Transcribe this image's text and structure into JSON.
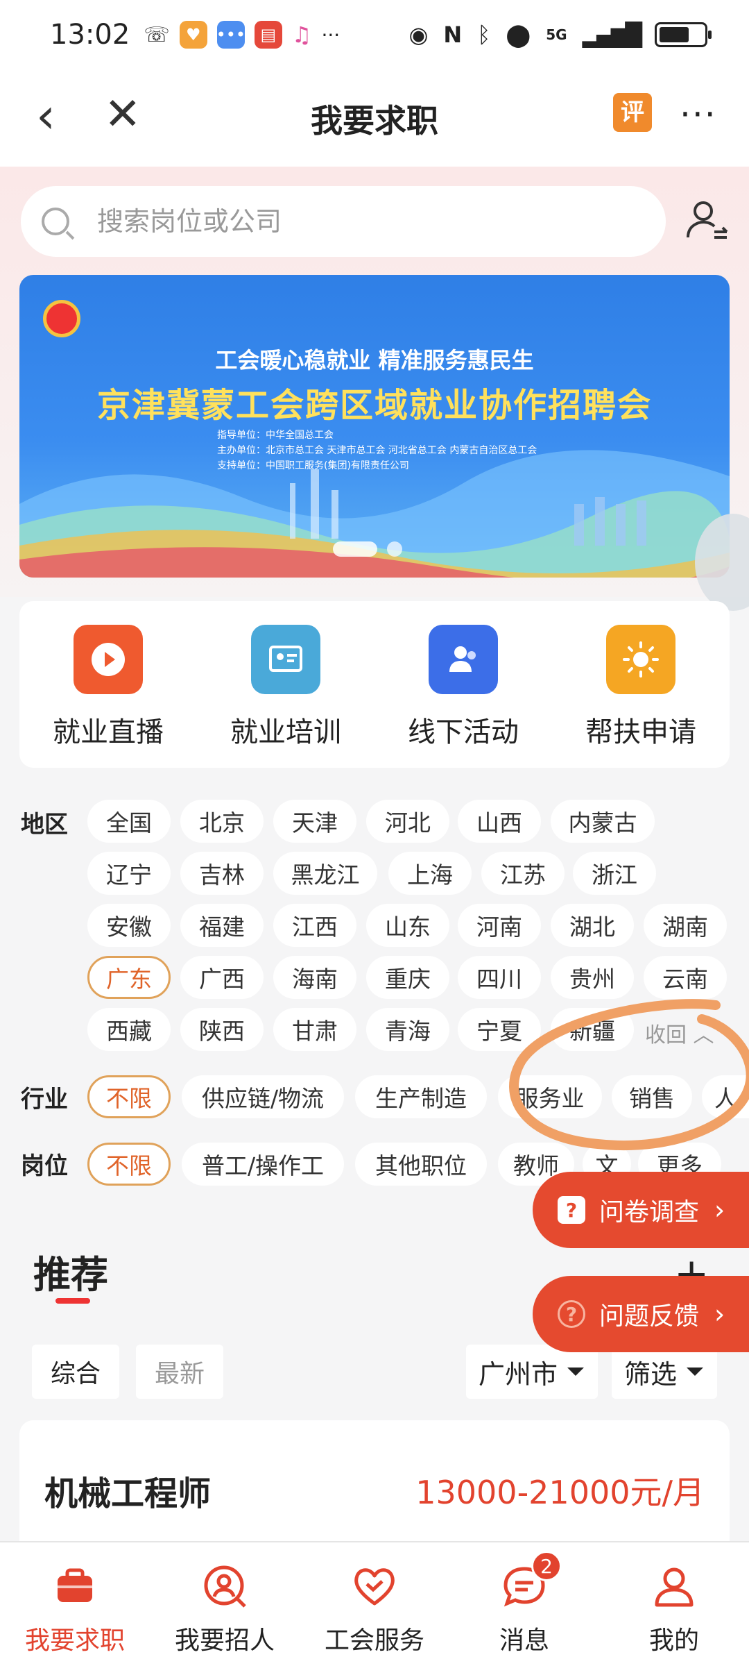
{
  "status_bar": {
    "time": "13:02",
    "more": "···",
    "network": "5G"
  },
  "nav": {
    "title": "我要求职",
    "review_badge": "评",
    "more": "···"
  },
  "search": {
    "placeholder": "搜索岗位或公司"
  },
  "banner": {
    "subtitle": "工会暖心稳就业   精准服务惠民生",
    "title": "京津冀蒙工会跨区域就业协作招聘会",
    "lines": [
      "指导单位：中华全国总工会",
      "主办单位：北京市总工会    天津市总工会    河北省总工会    内蒙古自治区总工会",
      "支持单位：中国职工服务(集团)有限责任公司"
    ]
  },
  "features": [
    {
      "label": "就业直播",
      "icon": "play-icon",
      "color": "#ef5a2f"
    },
    {
      "label": "就业培训",
      "icon": "training-icon",
      "color": "#4aa9d9"
    },
    {
      "label": "线下活动",
      "icon": "people-icon",
      "color": "#3c6ee8"
    },
    {
      "label": "帮扶申请",
      "icon": "sun-icon",
      "color": "#f5a623"
    }
  ],
  "filters": {
    "region_label": "地区",
    "regions": [
      "全国",
      "北京",
      "天津",
      "河北",
      "山西",
      "内蒙古",
      "辽宁",
      "吉林",
      "黑龙江",
      "上海",
      "江苏",
      "浙江",
      "安徽",
      "福建",
      "江西",
      "山东",
      "河南",
      "湖北",
      "湖南",
      "广东",
      "广西",
      "海南",
      "重庆",
      "四川",
      "贵州",
      "云南",
      "西藏",
      "陕西",
      "甘肃",
      "青海",
      "宁夏",
      "新疆"
    ],
    "region_selected": "广东",
    "collapse": "收回",
    "industry_label": "行业",
    "industries": [
      "不限",
      "供应链/物流",
      "生产制造",
      "服务业",
      "销售",
      "人"
    ],
    "position_label": "岗位",
    "positions": [
      "不限",
      "普工/操作工",
      "其他职位",
      "教师",
      "文",
      "更多"
    ]
  },
  "float_buttons": {
    "survey": "问卷调查",
    "feedback": "问题反馈"
  },
  "recommend": {
    "title": "推荐",
    "sort_tabs": [
      "综合",
      "最新"
    ],
    "city": "广州市",
    "filter": "筛选"
  },
  "job": {
    "title": "机械工程师",
    "salary": "13000-21000元/月"
  },
  "tabbar": [
    {
      "label": "我要求职",
      "icon": "briefcase-icon",
      "active": true
    },
    {
      "label": "我要招人",
      "icon": "recruit-icon",
      "active": false
    },
    {
      "label": "工会服务",
      "icon": "heart-icon",
      "active": false
    },
    {
      "label": "消息",
      "icon": "message-icon",
      "active": false,
      "badge": "2"
    },
    {
      "label": "我的",
      "icon": "user-icon",
      "active": false
    }
  ],
  "colors": {
    "accent": "#e2432e",
    "chip_active": "#e0a25a",
    "annotation": "#f0a065"
  }
}
